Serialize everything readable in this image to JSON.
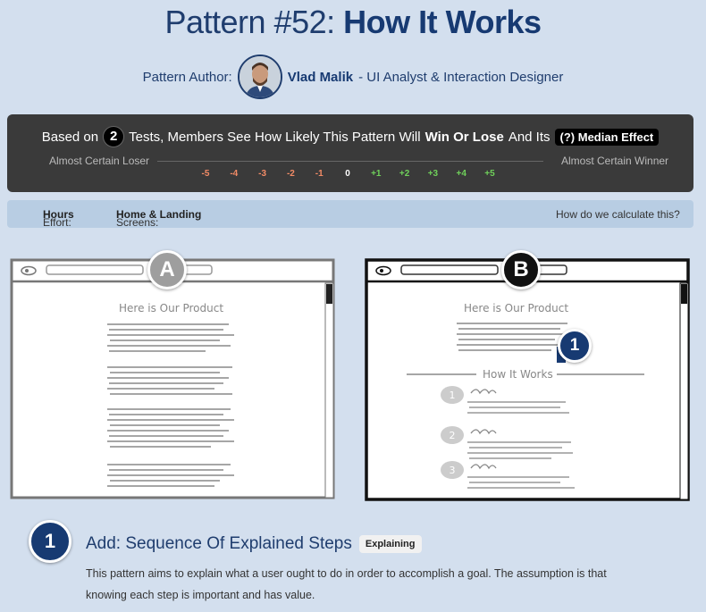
{
  "header": {
    "title_prefix": "Pattern #52:",
    "title_name": "How It Works"
  },
  "author": {
    "label": "Pattern Author:",
    "name": "Vlad Malik",
    "role": "- UI Analyst & Interaction Designer"
  },
  "effect": {
    "text_based_on": "Based on",
    "test_count": "2",
    "text_middle": "Tests, Members See How Likely This Pattern Will",
    "text_win_lose": "Win Or Lose",
    "text_and_its": "And Its",
    "median_label": "(?) Median Effect",
    "scale_left": "Almost Certain Loser",
    "scale_right": "Almost Certain Winner",
    "ticks": [
      "-5",
      "-4",
      "-3",
      "-2",
      "-1",
      "0",
      "+1",
      "+2",
      "+3",
      "+4",
      "+5"
    ],
    "colors": {
      "negative": "#f28b66",
      "zero": "#ffffff",
      "positive": "#6fd05a"
    }
  },
  "meta": {
    "effort_label": "Effort:",
    "effort_value": "Hours",
    "screens_label": "Screens:",
    "screens_value": "Home & Landing",
    "calc_link": "How do we calculate this?"
  },
  "variants": {
    "a": {
      "letter": "A",
      "heading": "Here is Our Product"
    },
    "b": {
      "letter": "B",
      "heading": "Here is Our Product",
      "marker": "1",
      "section": "How It Works",
      "steps": [
        "1",
        "2",
        "3"
      ]
    }
  },
  "change": {
    "number": "1",
    "title": "Add: Sequence Of Explained Steps",
    "tag": "Explaining",
    "description": "This pattern aims to explain what a user ought to do in order to accomplish a goal. The assumption is that knowing each step is important and has value."
  },
  "colors": {
    "navy": "#173a72",
    "background": "#d3dfee",
    "dark_panel": "#3a3a3a"
  }
}
